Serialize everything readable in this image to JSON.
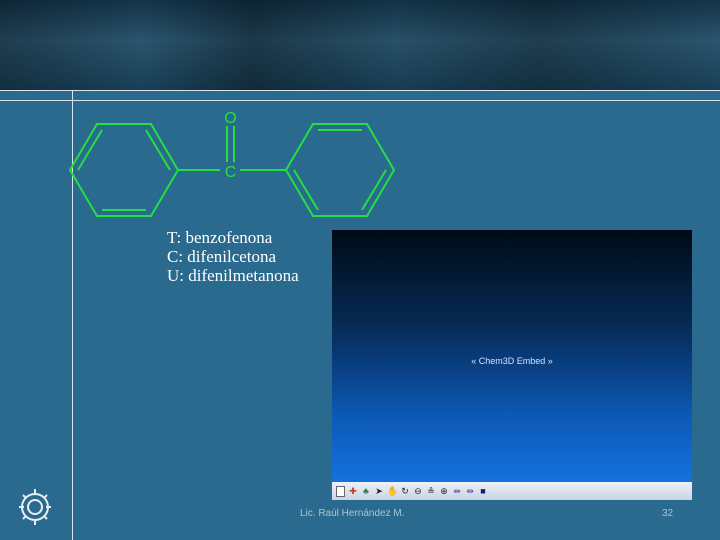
{
  "molecule": {
    "oxygen": "O",
    "carbon": "C",
    "color": "#22e040"
  },
  "names": [
    "T: benzofenona",
    "C: difenilcetona",
    "U: difenilmetanona"
  ],
  "embed": {
    "label": "« Chem3D Embed »",
    "toolbar_icons": [
      "file-icon",
      "rotate-icon",
      "tree-icon",
      "arrow-pointer-icon",
      "hand-icon",
      "rotate-3d-icon",
      "zoom-icon",
      "pivot-icon",
      "pivot-2-icon",
      "translate-icon",
      "translate-2-icon",
      "stop-icon"
    ]
  },
  "footer": {
    "author": "Lic. Raúl Hernández M.",
    "page": "32"
  }
}
